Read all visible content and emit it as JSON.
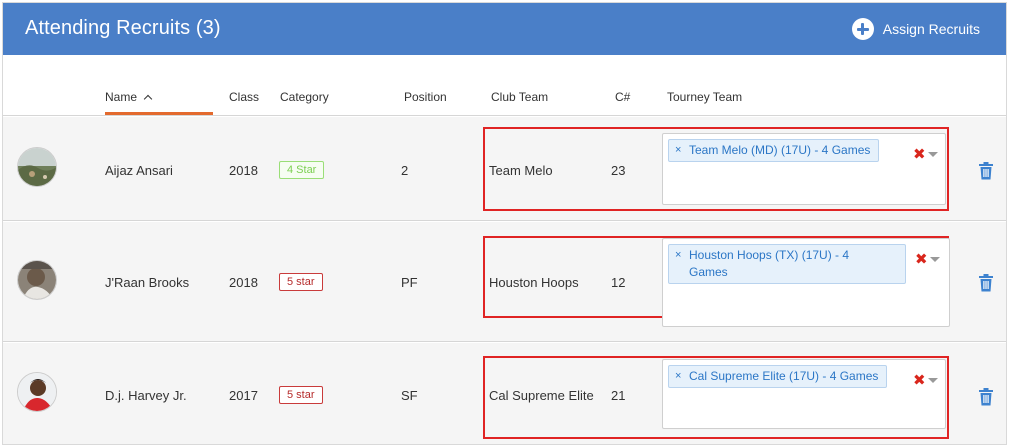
{
  "header": {
    "title": "Attending Recruits (3)",
    "assign_label": "Assign Recruits",
    "color": "#4a7fc8"
  },
  "columns": {
    "name": "Name",
    "class": "Class",
    "category": "Category",
    "position": "Position",
    "club_team": "Club Team",
    "c_number": "C#",
    "tourney_team": "Tourney Team"
  },
  "recruits": [
    {
      "name": "Aijaz Ansari",
      "class": "2018",
      "category": "4 Star",
      "category_color": "green",
      "position": "2",
      "club_team": "Team Melo",
      "c_number": "23",
      "tourney_team": "Team Melo (MD) (17U) - 4 Games"
    },
    {
      "name": "J'Raan Brooks",
      "class": "2018",
      "category": "5 star",
      "category_color": "red",
      "position": "PF",
      "club_team": "Houston Hoops",
      "c_number": "12",
      "tourney_team_line1": "Houston Hoops (TX) (17U) - 4",
      "tourney_team_line2": "Games"
    },
    {
      "name": "D.j. Harvey Jr.",
      "class": "2017",
      "category": "5 star",
      "category_color": "red",
      "position": "SF",
      "club_team": "Cal Supreme Elite",
      "c_number": "21",
      "tourney_team": "Cal Supreme Elite (17U) - 4 Games"
    }
  ],
  "icons": {
    "remove_tag": "×",
    "clear": "✖"
  },
  "colors": {
    "sort_underline": "#e36a2e",
    "highlight": "#e02424",
    "tag_text": "#2b76c6",
    "trash": "#3d82cf"
  }
}
